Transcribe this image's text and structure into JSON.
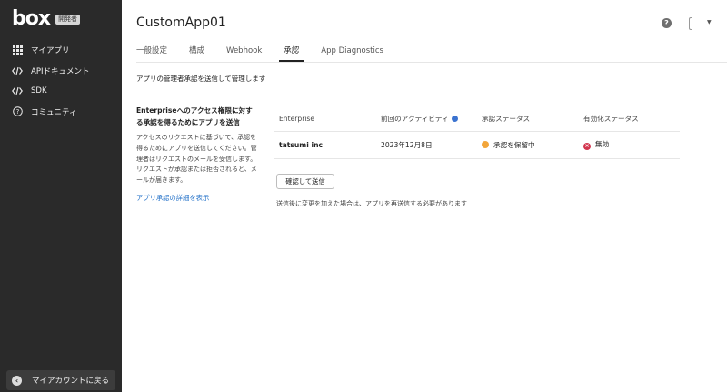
{
  "sidebar": {
    "logo": "box",
    "badge": "開発者",
    "items": [
      {
        "label": "マイアプリ",
        "icon": "grid-icon"
      },
      {
        "label": "APIドキュメント",
        "icon": "code-icon"
      },
      {
        "label": "SDK",
        "icon": "code-icon"
      },
      {
        "label": "コミュニティ",
        "icon": "help-circle-icon"
      }
    ],
    "back_label": "マイアカウントに戻る"
  },
  "header": {
    "app_title": "CustomApp01",
    "help_glyph": "?"
  },
  "tabs": [
    {
      "label": "一般設定",
      "active": false
    },
    {
      "label": "構成",
      "active": false
    },
    {
      "label": "Webhook",
      "active": false
    },
    {
      "label": "承認",
      "active": true
    },
    {
      "label": "App Diagnostics",
      "active": false
    }
  ],
  "main": {
    "description": "アプリの管理者承認を送信して管理します",
    "left_heading": "Enterpriseへのアクセス権限に対する承認を得るためにアプリを送信",
    "left_body": "アクセスのリクエストに基づいて、承認を得るためにアプリを送信してください。管理者はリクエストのメールを受信します。リクエストが承認または拒否されると、メールが届きます。",
    "left_link": "アプリ承認の詳細を表示",
    "table": {
      "headers": [
        "Enterprise",
        "前回のアクティビティ",
        "承認ステータス",
        "有効化ステータス"
      ],
      "rows": [
        {
          "enterprise": "tatsumi inc",
          "last_activity": "2023年12月8日",
          "approval_status": "承認を保留中",
          "activation_status": "無効"
        }
      ]
    },
    "confirm_button": "確認して送信",
    "note": "送信後に変更を加えた場合は、アプリを再送信する必要があります"
  },
  "colors": {
    "sidebar_bg": "#2a2a2a",
    "link": "#2673c9",
    "pending": "#f2a53a",
    "disabled": "#d2354e",
    "info": "#3b73d0"
  }
}
